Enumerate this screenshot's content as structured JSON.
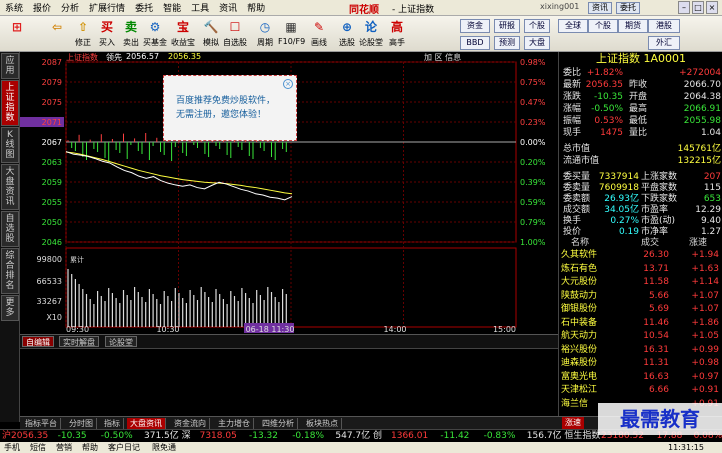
{
  "menu": {
    "items": [
      "系统",
      "报价",
      "分析",
      "扩展行情",
      "委托",
      "智能",
      "工具",
      "资讯",
      "帮助"
    ],
    "brand": "同花顺",
    "window_title": "- 上证指数",
    "user": "xixing001",
    "btn_info": "资讯",
    "btn_commission": "委托"
  },
  "toolbar": {
    "buttons": [
      {
        "icon": "⊞",
        "label": ""
      },
      {
        "icon": "⇦",
        "label": ""
      },
      {
        "icon": "⇧",
        "label": "修正"
      },
      {
        "icon": "买",
        "label": "买入"
      },
      {
        "icon": "卖",
        "label": "卖出"
      },
      {
        "icon": "⚙",
        "label": "买基金"
      },
      {
        "icon": "宝",
        "label": "收益宝"
      },
      {
        "icon": "🔨",
        "label": "模拟"
      },
      {
        "icon": "☐",
        "label": "自选股"
      },
      {
        "icon": "◷",
        "label": "周期"
      },
      {
        "icon": "▦",
        "label": "F10/F9"
      },
      {
        "icon": "✎",
        "label": "画线"
      },
      {
        "icon": "⊕",
        "label": "选股"
      },
      {
        "icon": "论",
        "label": "论股堂"
      },
      {
        "icon": "高",
        "label": "高手"
      }
    ],
    "right_buttons": [
      "资金",
      "BBD",
      "研报",
      "预测",
      "个股",
      "大盘",
      "全球",
      "个股",
      "期货",
      "港股",
      "外汇"
    ]
  },
  "left_tabs": [
    {
      "label": "应用",
      "active": false
    },
    {
      "label": "上证指数",
      "active": true
    },
    {
      "label": "K线图",
      "active": false
    },
    {
      "label": "大盘资讯",
      "active": false
    },
    {
      "label": "自选股",
      "active": false
    },
    {
      "label": "综合排名",
      "active": false
    },
    {
      "label": "更多",
      "active": false
    }
  ],
  "chart_top": {
    "name": "上证指数",
    "tag": "领先",
    "v1": "2056.57",
    "v2": "2056.35",
    "right": "加 区 信息"
  },
  "chart_data": {
    "type": "line",
    "title": "上证指数",
    "y_price_labels": [
      "2087",
      "2079",
      "2075",
      "2071",
      "2067",
      "2063",
      "2059",
      "2055",
      "2050",
      "2046"
    ],
    "y_pct_labels": [
      "0.98%",
      "0.75%",
      "0.47%",
      "0.23%",
      "0.00%",
      "0.20%",
      "0.39%",
      "0.59%",
      "0.79%",
      "1.00%"
    ],
    "y_vol_labels": [
      "99800",
      "66533",
      "33267",
      "X10"
    ],
    "x_labels": [
      "09:30",
      "10:30",
      "06-18 11:30",
      "14:00",
      "15:00"
    ],
    "ylim": [
      2046,
      2087
    ],
    "price": [
      2066.6,
      2066.0,
      2065.8,
      2065.5,
      2065.0,
      2064.4,
      2064.0,
      2063.1,
      2062.3,
      2061.8,
      2061.0,
      2060.5,
      2060.9,
      2060.0,
      2059.4,
      2059.0,
      2058.7,
      2059.0,
      2058.4,
      2058.1,
      2058.9,
      2059.6,
      2059.2,
      2058.6,
      2058.0,
      2057.6,
      2057.0,
      2056.7,
      2056.2,
      2056.0,
      2055.6,
      2056.35
    ],
    "avg": [
      2066.5,
      2066.3,
      2066.0,
      2065.6,
      2065.2,
      2064.8,
      2064.3,
      2063.8,
      2063.3,
      2062.8,
      2062.3,
      2061.9,
      2061.5,
      2061.1,
      2060.8,
      2060.5,
      2060.2,
      2060.0,
      2059.8,
      2059.6,
      2059.5,
      2059.4,
      2059.3,
      2059.1,
      2058.9,
      2058.6,
      2058.4,
      2058.1,
      2057.8,
      2057.5,
      2057.2,
      2057.0
    ],
    "cumulative_label": "累计"
  },
  "popup": {
    "line1": "百度推荐免费炒股软件，",
    "line2": "无需注册，邀您体验！"
  },
  "bottom_tabs": [
    {
      "label": "自编辑",
      "active": true
    },
    {
      "label": "实时解盘",
      "active": false
    },
    {
      "label": "论股堂",
      "active": false
    }
  ],
  "stock_tabs": [
    {
      "label": "指标平台",
      "active": false
    },
    {
      "label": "分时图",
      "active": false
    },
    {
      "label": "指标",
      "active": false
    },
    {
      "label": "大盘资讯",
      "active": true
    },
    {
      "label": "资金流向",
      "active": false
    },
    {
      "label": "主力增仓",
      "active": false
    },
    {
      "label": "四维分析",
      "active": false
    },
    {
      "label": "板块热点",
      "active": false
    }
  ],
  "quote": {
    "title": "上证指数 1A0001",
    "rows": [
      [
        "委比",
        "+1.82%",
        "",
        "+272004"
      ],
      [
        "最新",
        "2056.35",
        "昨收",
        "2066.70"
      ],
      [
        "涨跌",
        "-10.35",
        "开盘",
        "2064.38"
      ],
      [
        "涨幅",
        "-0.50%",
        "最高",
        "2066.91"
      ],
      [
        "振幅",
        "0.53%",
        "最低",
        "2055.98"
      ],
      [
        "现手",
        "1475",
        "量比",
        "1.04"
      ]
    ],
    "rows2": [
      [
        "总市值",
        "",
        "145761亿"
      ],
      [
        "流通市值",
        "",
        "132215亿"
      ]
    ],
    "rows3": [
      [
        "委买量",
        "7337914",
        "上涨家数",
        "207"
      ],
      [
        "委卖量",
        "7609918",
        "平盘家数",
        "115"
      ],
      [
        "委卖额",
        "26.93亿",
        "下跌家数",
        "653"
      ],
      [
        "成交额",
        "34.05亿",
        "市盈率",
        "12.29"
      ],
      [
        "换手",
        "0.27%",
        "市盈(动)",
        "9.40"
      ],
      [
        "投价",
        "0.19",
        "市净率",
        "1.27"
      ]
    ],
    "list_header": [
      "名称",
      "成交",
      "涨速"
    ],
    "list": [
      [
        "久其软件",
        "26.30",
        "+1.94"
      ],
      [
        "炼石有色",
        "13.71",
        "+1.63"
      ],
      [
        "大元股份",
        "11.58",
        "+1.14"
      ],
      [
        "陕鼓动力",
        "5.66",
        "+1.07"
      ],
      [
        "御银股份",
        "5.69",
        "+1.07"
      ],
      [
        "石中装备",
        "11.46",
        "+1.86"
      ],
      [
        "航天动力",
        "10.54",
        "+1.05"
      ],
      [
        "裕兴股份",
        "16.31",
        "+0.99"
      ],
      [
        "迪森股份",
        "11.31",
        "+0.98"
      ],
      [
        "富奥光电",
        "16.63",
        "+0.97"
      ],
      [
        "天津松江",
        "6.66",
        "+0.91"
      ],
      [
        "海兰信",
        "",
        "+0.91"
      ]
    ],
    "bottom_label": "涨速"
  },
  "ticker": {
    "items": [
      {
        "t": "沪2056.35",
        "c": "red"
      },
      {
        "t": "-10.35",
        "c": "grn"
      },
      {
        "t": "-0.50%",
        "c": "grn"
      },
      {
        "t": "371.5亿 深",
        "c": "wht"
      },
      {
        "t": "7318.05",
        "c": "red"
      },
      {
        "t": "-13.32",
        "c": "grn"
      },
      {
        "t": "-0.18%",
        "c": "grn"
      },
      {
        "t": "547.7亿 创",
        "c": "wht"
      },
      {
        "t": "1366.01",
        "c": "red"
      },
      {
        "t": "-11.42",
        "c": "grn"
      },
      {
        "t": "-0.83%",
        "c": "grn"
      },
      {
        "t": "156.7亿 恒生指数",
        "c": "wht"
      },
      {
        "t": "23180.52",
        "c": "red"
      },
      {
        "t": "17.88",
        "c": "red"
      },
      {
        "t": "0.08%",
        "c": "red"
      }
    ]
  },
  "statusbar": {
    "items": [
      "手机",
      "短信",
      "营销",
      "帮助",
      "客户日记",
      "限免通"
    ],
    "time": "11:31:15"
  },
  "watermark": "最需教育"
}
